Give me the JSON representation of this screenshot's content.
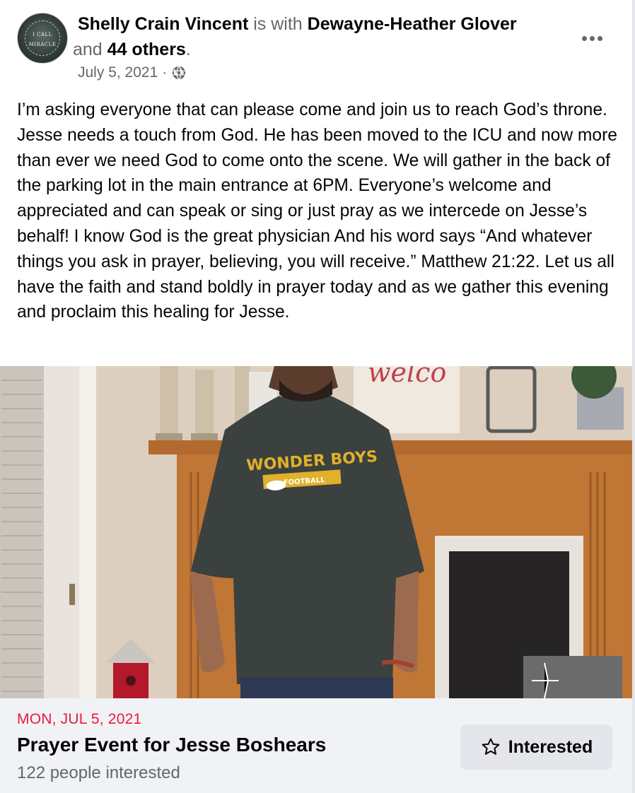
{
  "post": {
    "author": "Shelly Crain Vincent",
    "with_word": " is with ",
    "tagged": "Dewayne-Heather Glover",
    "and_word": " and ",
    "others": "44 others",
    "period": ".",
    "date": "July 5, 2021",
    "separator": "·",
    "privacy_icon": "globe-icon",
    "more_icon": "more-options-icon",
    "avatar_text_1": "I CALL",
    "avatar_text_2": "MIRACLE",
    "body": "I’m asking everyone that can please come and join us to reach God’s throne. Jesse needs a touch from God. He has been moved to the ICU and now more than ever we need God to come onto the scene. We will gather in the back of the parking lot in the main entrance at 6PM. Everyone’s welcome and appreciated and can speak or sing or just pray as we intercede on Jesse’s behalf! I know God is the great physician And his word says “And whatever things you ask in prayer, believing, you will receive.” Matthew 21:22. Let us all have the faith and stand boldly in prayer today and as we gather this evening and proclaim this healing for Jesse."
  },
  "photo": {
    "shirt_line1": "WONDER BOYS",
    "shirt_line2": "FOOTBALL"
  },
  "event": {
    "date": "MON, JUL 5, 2021",
    "title": "Prayer Event for Jesse Boshears",
    "interested_count": "122 people interested",
    "button_label": "Interested",
    "button_icon": "star-icon"
  },
  "colors": {
    "event_date": "#e41e3f",
    "secondary_text": "#65676b",
    "event_bg": "#f0f2f5",
    "button_bg": "#e4e6eb"
  }
}
